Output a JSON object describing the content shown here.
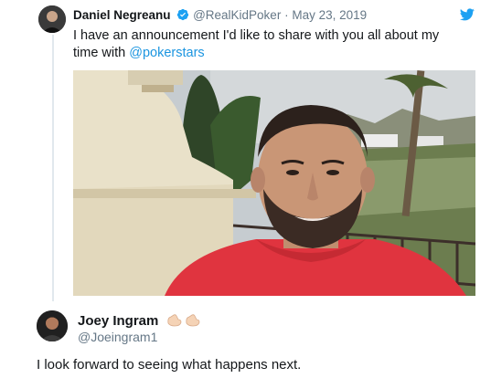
{
  "tweet1": {
    "display_name": "Daniel Negreanu",
    "handle": "@RealKidPoker",
    "separator": "·",
    "date": "May 23, 2019",
    "text_before": "I have an announcement I'd like to share with you all about my time with ",
    "mention": "@pokerstars",
    "verified_icon": "verified-badge-icon",
    "brand_color": "#1da1f2"
  },
  "tweet2": {
    "display_name": "Joey Ingram",
    "handle": "@Joeingram1",
    "text": "I look forward to seeing what happens next.",
    "emoji": "call-me-hand-emoji x2"
  },
  "colors": {
    "link": "#1b95e0",
    "secondary_text": "#657786",
    "primary_text": "#14171a",
    "shirt": "#e0343f"
  }
}
